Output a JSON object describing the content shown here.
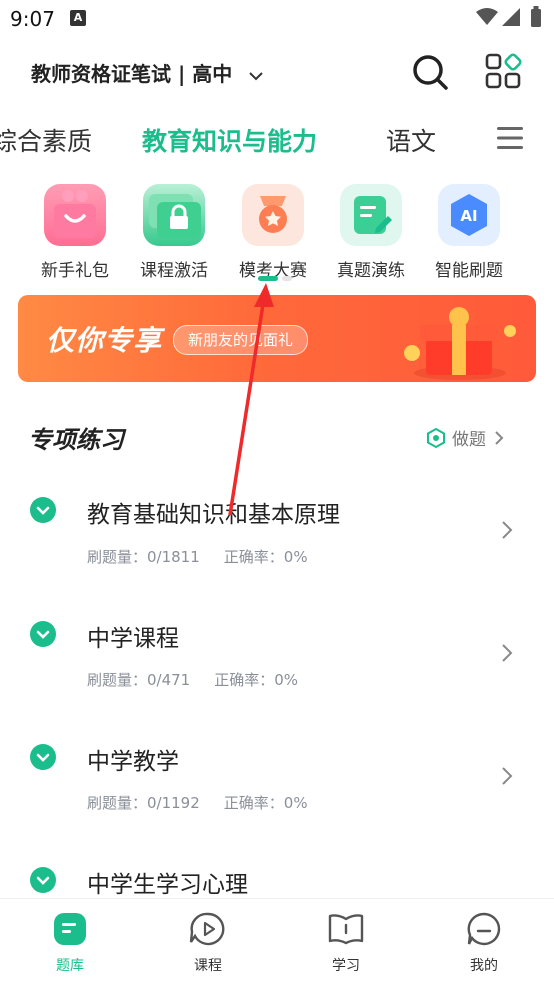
{
  "status_bar": {
    "time": "9:07",
    "a_badge": "A"
  },
  "header": {
    "exam_selector": "教师资格证笔试 | 高中"
  },
  "tabs": [
    {
      "label": "综合素质",
      "active": false
    },
    {
      "label": "教育知识与能力",
      "active": true
    },
    {
      "label": "语文",
      "active": false
    }
  ],
  "quick_actions": [
    {
      "label": "新手礼包",
      "icon": "gift-icon"
    },
    {
      "label": "课程激活",
      "icon": "lock-icon"
    },
    {
      "label": "模考大赛",
      "icon": "medal-icon"
    },
    {
      "label": "真题演练",
      "icon": "edit-icon"
    },
    {
      "label": "智能刷题",
      "icon": "ai-icon",
      "icon_text": "AI"
    }
  ],
  "banner": {
    "headline": "仅你专享",
    "pill": "新朋友的见面礼"
  },
  "section": {
    "title": "专项练习",
    "link": "做题"
  },
  "practice": [
    {
      "title": "教育基础知识和基本原理",
      "count_label": "刷题量：0/1811",
      "accuracy_label": "正确率：0%"
    },
    {
      "title": "中学课程",
      "count_label": "刷题量：0/471",
      "accuracy_label": "正确率：0%"
    },
    {
      "title": "中学教学",
      "count_label": "刷题量：0/1192",
      "accuracy_label": "正确率：0%"
    },
    {
      "title": "中学生学习心理",
      "count_label": "",
      "accuracy_label": ""
    }
  ],
  "bottom_nav": [
    {
      "label": "题库",
      "icon": "question-bank-icon",
      "active": true
    },
    {
      "label": "课程",
      "icon": "course-play-icon",
      "active": false
    },
    {
      "label": "学习",
      "icon": "book-icon",
      "active": false
    },
    {
      "label": "我的",
      "icon": "profile-chat-icon",
      "active": false
    }
  ],
  "colors": {
    "accent": "#1bbd8c",
    "banner": "#ff6a3a",
    "annotation_arrow": "#f02a2a"
  }
}
